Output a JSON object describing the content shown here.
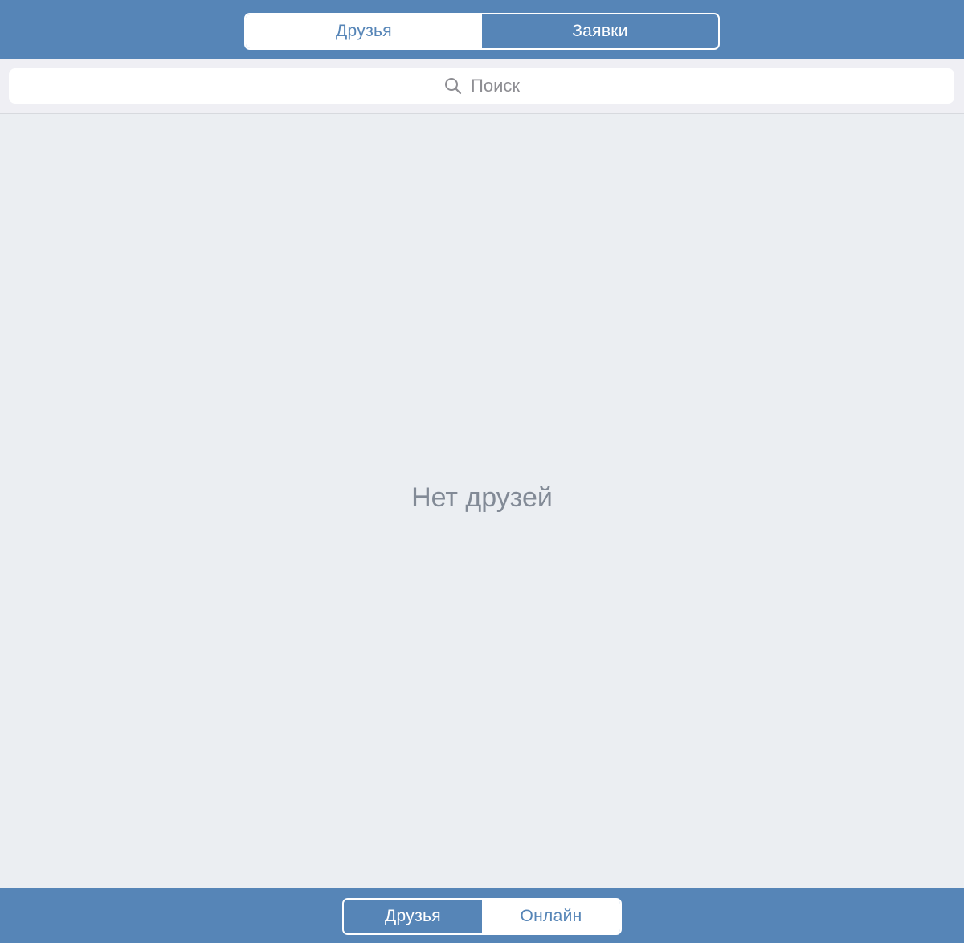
{
  "header": {
    "tabs": [
      {
        "label": "Друзья",
        "selected": true
      },
      {
        "label": "Заявки",
        "selected": false
      }
    ]
  },
  "search": {
    "placeholder": "Поиск",
    "icon": "search-icon"
  },
  "main": {
    "empty_message": "Нет друзей"
  },
  "footer": {
    "filters": [
      {
        "label": "Друзья",
        "selected": true
      },
      {
        "label": "Онлайн",
        "selected": false
      }
    ]
  },
  "colors": {
    "accent": "#5685b7",
    "background": "#ebeef2",
    "empty_text": "#828a96"
  }
}
